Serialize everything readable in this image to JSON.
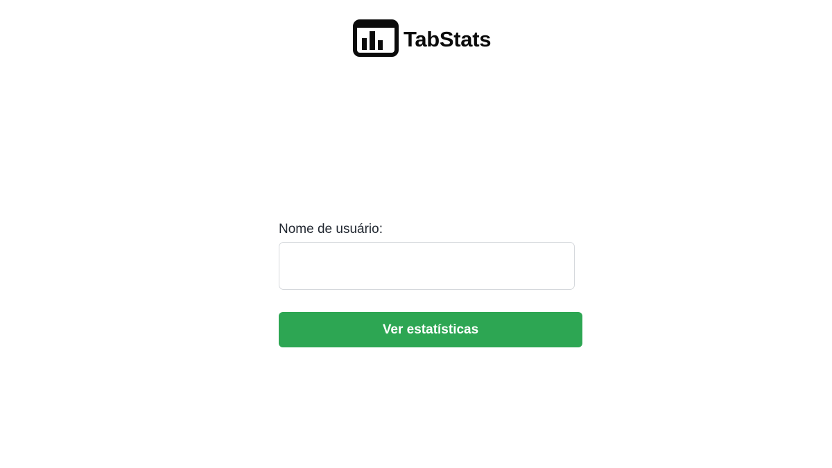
{
  "brand": {
    "name": "TabStats",
    "icon": "bar-chart-window-icon"
  },
  "form": {
    "username_label": "Nome de usuário:",
    "username_value": "",
    "submit_label": "Ver estatísticas"
  },
  "colors": {
    "accent": "#2da653",
    "text": "#222831",
    "input_border": "#d5d8dc"
  }
}
